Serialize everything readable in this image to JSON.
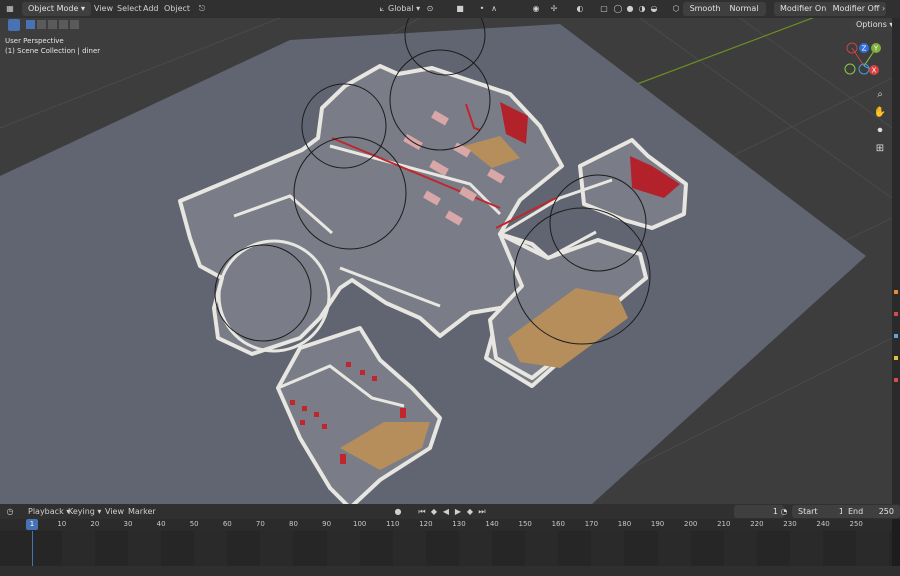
{
  "header": {
    "mode": "Object Mode",
    "menus": [
      "View",
      "Select",
      "Add",
      "Object"
    ],
    "transform_orientation": "Global",
    "smooth_label": "Smooth",
    "normal_label": "Normal",
    "modifier_on_label": "Modifier On",
    "modifier_off_label": "Modifier Off",
    "options_label": "Options"
  },
  "viewport": {
    "perspective": "User Perspective",
    "collection": "(1) Scene Collection | diner",
    "gizmo": {
      "x": "X",
      "y": "Y",
      "z": "Z"
    }
  },
  "timeline": {
    "menus": [
      "Playback",
      "Keying",
      "View",
      "Marker"
    ],
    "current_frame": "1",
    "start_label": "Start",
    "start_value": "1",
    "end_label": "End",
    "end_value": "250",
    "ticks": [
      "1",
      "10",
      "20",
      "30",
      "40",
      "50",
      "60",
      "70",
      "80",
      "90",
      "100",
      "110",
      "120",
      "130",
      "140",
      "150",
      "160",
      "170",
      "180",
      "190",
      "200",
      "210",
      "220",
      "230",
      "240",
      "250"
    ]
  },
  "colors": {
    "accent": "#4772b3",
    "header": "#303030",
    "viewport_bg": "#3d3d3d",
    "floor": "#616572"
  }
}
